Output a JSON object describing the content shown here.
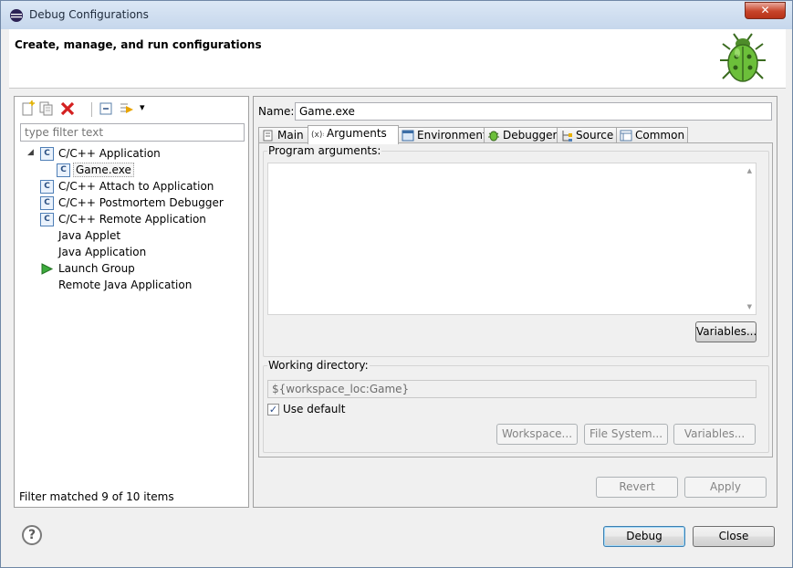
{
  "window": {
    "title": "Debug Configurations",
    "close_label": "✕"
  },
  "header": {
    "title": "Create, manage, and run configurations"
  },
  "toolbar": {
    "dropdown": "▾"
  },
  "filter": {
    "placeholder": "type filter text"
  },
  "tree": {
    "items": [
      {
        "label": "C/C++ Application",
        "icon": "c-config-icon",
        "expanded": true
      },
      {
        "label": "Game.exe",
        "icon": "c-config-icon",
        "selected": true
      },
      {
        "label": "C/C++ Attach to Application",
        "icon": "c-config-icon"
      },
      {
        "label": "C/C++ Postmortem Debugger",
        "icon": "c-config-icon"
      },
      {
        "label": "C/C++ Remote Application",
        "icon": "c-config-icon"
      },
      {
        "label": "Java Applet",
        "icon": "none"
      },
      {
        "label": "Java Application",
        "icon": "none"
      },
      {
        "label": "Launch Group",
        "icon": "launch-group-icon"
      },
      {
        "label": "Remote Java Application",
        "icon": "none"
      }
    ],
    "twisty": "◢"
  },
  "status": {
    "text": "Filter matched 9 of 10 items"
  },
  "name": {
    "label": "Name:",
    "value": "Game.exe"
  },
  "tabs": [
    {
      "label": "Main",
      "icon": "main-tab-icon"
    },
    {
      "label": "Arguments",
      "icon": "arguments-tab-icon",
      "active": true
    },
    {
      "label": "Environment",
      "icon": "environment-tab-icon"
    },
    {
      "label": "Debugger",
      "icon": "debugger-tab-icon"
    },
    {
      "label": "Source",
      "icon": "source-tab-icon"
    },
    {
      "label": "Common",
      "icon": "common-tab-icon"
    }
  ],
  "arguments": {
    "program_args_label": "Program arguments:",
    "program_args_value": "",
    "variables_label": "Variables...",
    "working_dir_label": "Working directory:",
    "working_dir_value": "${workspace_loc:Game}",
    "use_default_label": "Use default",
    "use_default_checked": true,
    "workspace_label": "Workspace...",
    "filesystem_label": "File System...",
    "variables2_label": "Variables..."
  },
  "actions": {
    "revert_label": "Revert",
    "apply_label": "Apply"
  },
  "footer": {
    "help_label": "?",
    "debug_label": "Debug",
    "close_label": "Close"
  },
  "colors": {
    "accent": "#3c7fb1",
    "titlebar": "#c6d7ec",
    "close": "#c7442a"
  }
}
